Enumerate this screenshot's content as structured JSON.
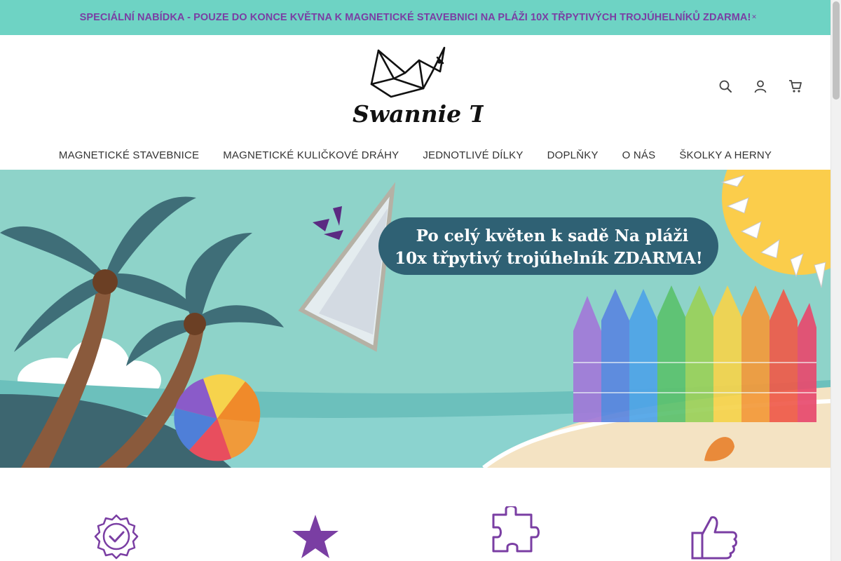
{
  "announcement": {
    "text": "SPECIÁLNÍ NABÍDKA - POUZE DO KONCE KVĚTNA K MAGNETICKÉ STAVEBNICI NA PLÁŽI 10X TŘPYTIVÝCH TROJÚHELNÍKŮ ZDARMA!",
    "close_icon": "close-icon"
  },
  "brand": {
    "name": "Swannie Toys",
    "accent": "#7a3ea3",
    "teal": "#6ed3c4"
  },
  "header_icons": [
    "search-icon",
    "user-icon",
    "cart-icon"
  ],
  "nav": {
    "items": [
      "MAGNETICKÉ STAVEBNICE",
      "MAGNETICKÉ KULIČKOVÉ DRÁHY",
      "JEDNOTLIVÉ DÍLKY",
      "DOPLŇKY",
      "O NÁS",
      "ŠKOLKY A HERNY"
    ]
  },
  "hero": {
    "line1": "Po celý květen k sadě Na pláži",
    "line2": "10x třpytivý trojúhelník ZDARMA!"
  },
  "features": {
    "icons": [
      "quality-badge-icon",
      "star-icon",
      "puzzle-icon",
      "thumbs-up-icon"
    ]
  }
}
